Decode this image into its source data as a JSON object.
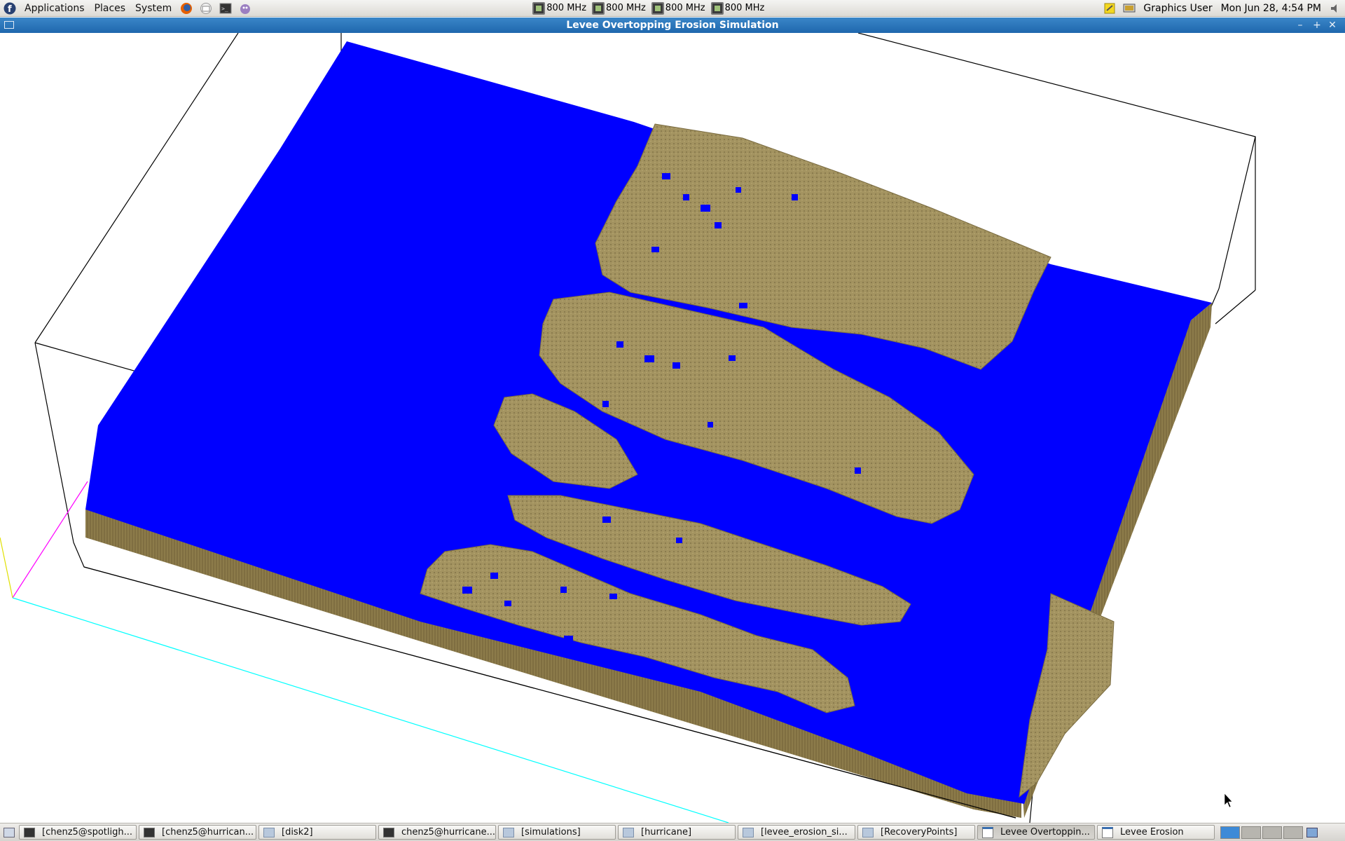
{
  "top_panel": {
    "menus": [
      "Applications",
      "Places",
      "System"
    ],
    "cpu_freqs": [
      "800 MHz",
      "800 MHz",
      "800 MHz",
      "800 MHz"
    ],
    "user": "Graphics User",
    "clock": "Mon Jun 28,  4:54 PM"
  },
  "window": {
    "title": "Levee Overtopping Erosion Simulation"
  },
  "viewport": {
    "water_color": "#0000ff",
    "soil_color": "#9b8a5a",
    "box_line_color": "#000000"
  },
  "taskbar": {
    "tasks": [
      {
        "label": "[chenz5@spotligh...",
        "icon": "terminal-icon"
      },
      {
        "label": "[chenz5@hurrican...",
        "icon": "terminal-icon"
      },
      {
        "label": "[disk2]",
        "icon": "folder-icon"
      },
      {
        "label": "chenz5@hurricane...",
        "icon": "terminal-icon"
      },
      {
        "label": "[simulations]",
        "icon": "folder-icon"
      },
      {
        "label": "[hurricane]",
        "icon": "folder-icon"
      },
      {
        "label": "[levee_erosion_si...",
        "icon": "folder-icon"
      },
      {
        "label": "[RecoveryPoints]",
        "icon": "folder-icon"
      },
      {
        "label": "Levee Overtoppin...",
        "icon": "window-icon"
      },
      {
        "label": "Levee Erosion",
        "icon": "window-icon"
      }
    ],
    "active_workspace": 1
  }
}
